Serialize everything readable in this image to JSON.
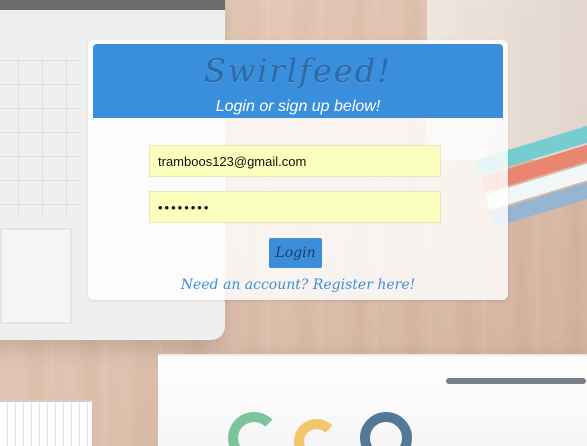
{
  "login_card": {
    "title": "Swirlfeed!",
    "subtitle": "Login or sign up below!",
    "email": {
      "value": "tramboos123@gmail.com",
      "placeholder": ""
    },
    "password": {
      "value": "••••••••",
      "placeholder": ""
    },
    "login_button_label": "Login",
    "register_link_text": "Need an account? Register here!"
  },
  "theme": {
    "header_blue": "#3a8fdc",
    "brand_text_blue": "#2f69a6",
    "input_fill": "#faffbd"
  }
}
